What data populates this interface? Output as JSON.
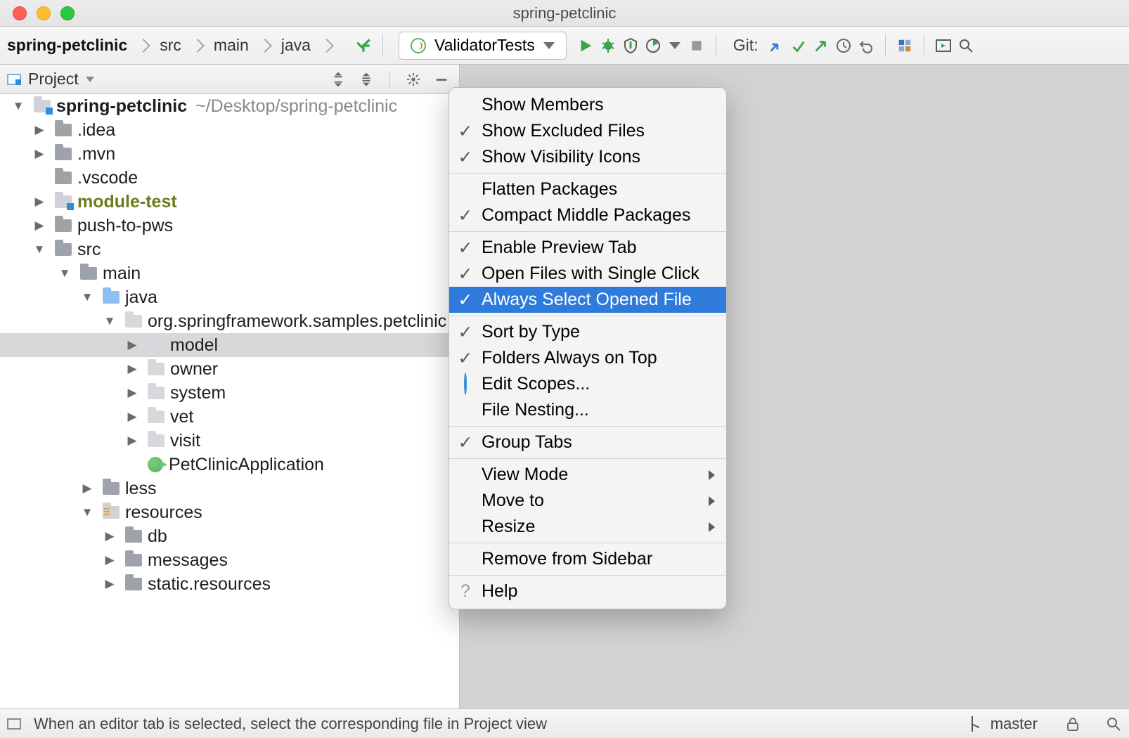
{
  "window": {
    "title": "spring-petclinic"
  },
  "breadcrumbs": {
    "root": "spring-petclinic",
    "items": [
      "src",
      "main",
      "java"
    ]
  },
  "toolbar": {
    "run_config": "ValidatorTests",
    "git_label": "Git:"
  },
  "toolwin": {
    "title": "Project"
  },
  "tree": {
    "root_name": "spring-petclinic",
    "root_path": "~/Desktop/spring-petclinic",
    "idea": ".idea",
    "mvn": ".mvn",
    "vscode": ".vscode",
    "module_test": "module-test",
    "push_to_pws": "push-to-pws",
    "src": "src",
    "main": "main",
    "java": "java",
    "pkg": "org.springframework.samples.petclinic",
    "model": "model",
    "owner": "owner",
    "system": "system",
    "vet": "vet",
    "visit": "visit",
    "app": "PetClinicApplication",
    "less": "less",
    "resources": "resources",
    "db": "db",
    "messages": "messages",
    "static_resources": "static.resources"
  },
  "popup": {
    "show_members": "Show Members",
    "show_excluded": "Show Excluded Files",
    "show_visibility": "Show Visibility Icons",
    "flatten_packages": "Flatten Packages",
    "compact_middle": "Compact Middle Packages",
    "enable_preview": "Enable Preview Tab",
    "open_single_click": "Open Files with Single Click",
    "always_select": "Always Select Opened File",
    "sort_by_type": "Sort by Type",
    "folders_top": "Folders Always on Top",
    "edit_scopes": "Edit Scopes...",
    "file_nesting": "File Nesting...",
    "group_tabs": "Group Tabs",
    "view_mode": "View Mode",
    "move_to": "Move to",
    "resize": "Resize",
    "remove_sidebar": "Remove from Sidebar",
    "help": "Help"
  },
  "status": {
    "hint": "When an editor tab is selected, select the corresponding file in Project view",
    "branch": "master"
  }
}
